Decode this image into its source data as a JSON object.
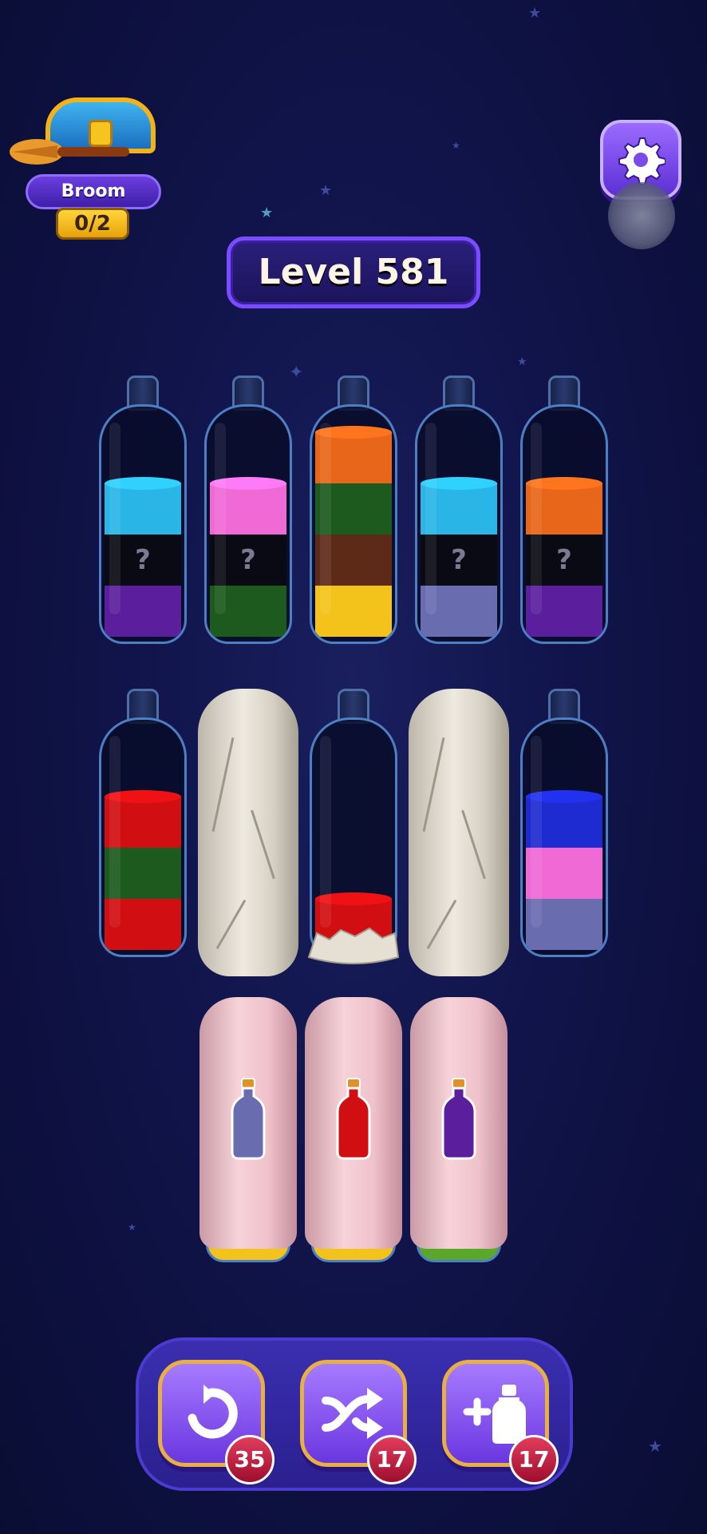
{
  "broom_streak": {
    "label": "Broom Streak",
    "count": "0/2"
  },
  "level": {
    "label": "Level 581"
  },
  "colors": {
    "cyan": "#29b6e6",
    "pink": "#f06ad6",
    "orange": "#e8661a",
    "dark_green": "#1d5a1e",
    "brown": "#5e2a18",
    "yellow": "#f3c31c",
    "purple": "#5b1f9e",
    "slate": "#6a6cb0",
    "red": "#d10f12",
    "blue": "#1e2bd0",
    "hidden": "#0a0a14"
  },
  "row1": [
    {
      "segments": [
        "cyan",
        "hidden",
        "purple"
      ]
    },
    {
      "segments": [
        "pink",
        "hidden",
        "dark_green"
      ]
    },
    {
      "segments": [
        "orange",
        "dark_green",
        "brown",
        "yellow"
      ]
    },
    {
      "segments": [
        "cyan",
        "hidden",
        "slate"
      ]
    },
    {
      "segments": [
        "orange",
        "hidden",
        "purple"
      ]
    }
  ],
  "row2": [
    {
      "type": "bottle",
      "segments": [
        "red",
        "dark_green",
        "red"
      ]
    },
    {
      "type": "stone"
    },
    {
      "type": "bottle-rubble",
      "segments": [
        "red"
      ]
    },
    {
      "type": "stone"
    },
    {
      "type": "bottle",
      "segments": [
        "blue",
        "pink",
        "slate"
      ]
    }
  ],
  "row3": [
    {
      "icon": "covered-bottle-slate",
      "base": "yellow"
    },
    {
      "icon": "covered-bottle-red",
      "base": "yellow"
    },
    {
      "icon": "covered-bottle-purple",
      "base": "green"
    }
  ],
  "hidden_mark": "?",
  "powerups": {
    "undo": {
      "icon": "undo-icon",
      "count": "35"
    },
    "shuffle": {
      "icon": "shuffle-icon",
      "count": "17"
    },
    "add_bottle": {
      "icon": "add-bottle-icon",
      "count": "17"
    }
  }
}
